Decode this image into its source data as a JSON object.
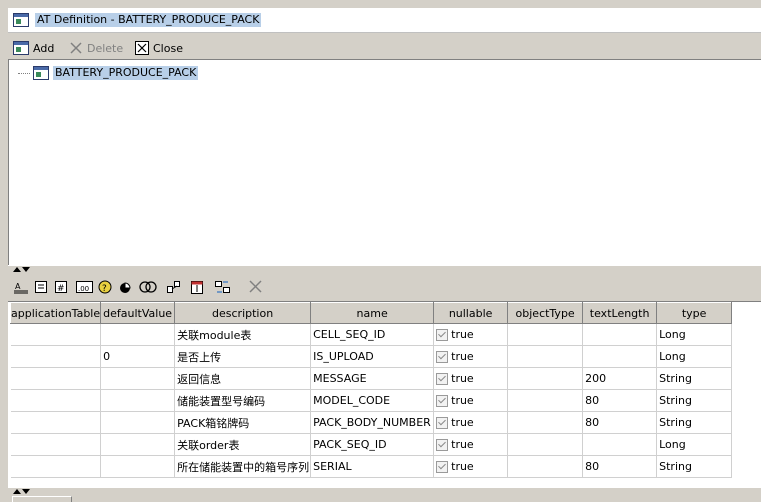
{
  "window": {
    "title": "AT Definition - BATTERY_PRODUCE_PACK"
  },
  "toolbar": {
    "add_label": "Add",
    "delete_label": "Delete",
    "close_label": "Close"
  },
  "tree": {
    "root_label": "BATTERY_PRODUCE_PACK"
  },
  "table_toolbar": {
    "icons": [
      "sort-asc-icon",
      "form-view-icon",
      "numeric-icon",
      "decimal-icon",
      "find-icon",
      "color-icon",
      "link-icon",
      "move-icon",
      "calendar-icon",
      "swap-icon",
      "delete-x-icon"
    ]
  },
  "grid": {
    "columns": [
      "applicationTable",
      "defaultValue",
      "description",
      "name",
      "nullable",
      "objectType",
      "textLength",
      "type"
    ],
    "rows": [
      {
        "applicationTable": "",
        "defaultValue": "",
        "description": "关联module表",
        "name": "CELL_SEQ_ID",
        "nullable": "true",
        "objectType": "",
        "textLength": "",
        "type": "Long"
      },
      {
        "applicationTable": "",
        "defaultValue": "0",
        "description": "是否上传",
        "name": "IS_UPLOAD",
        "nullable": "true",
        "objectType": "",
        "textLength": "",
        "type": "Long"
      },
      {
        "applicationTable": "",
        "defaultValue": "",
        "description": "返回信息",
        "name": "MESSAGE",
        "nullable": "true",
        "objectType": "",
        "textLength": "200",
        "type": "String"
      },
      {
        "applicationTable": "",
        "defaultValue": "",
        "description": "储能装置型号编码",
        "name": "MODEL_CODE",
        "nullable": "true",
        "objectType": "",
        "textLength": "80",
        "type": "String"
      },
      {
        "applicationTable": "",
        "defaultValue": "",
        "description": "PACK箱铭牌码",
        "name": "PACK_BODY_NUMBER",
        "nullable": "true",
        "objectType": "",
        "textLength": "80",
        "type": "String"
      },
      {
        "applicationTable": "",
        "defaultValue": "",
        "description": "关联order表",
        "name": "PACK_SEQ_ID",
        "nullable": "true",
        "objectType": "",
        "textLength": "",
        "type": "Long"
      },
      {
        "applicationTable": "",
        "defaultValue": "",
        "description": "所在储能装置中的箱号序列",
        "name": "SERIAL",
        "nullable": "true",
        "objectType": "",
        "textLength": "80",
        "type": "String"
      }
    ]
  }
}
